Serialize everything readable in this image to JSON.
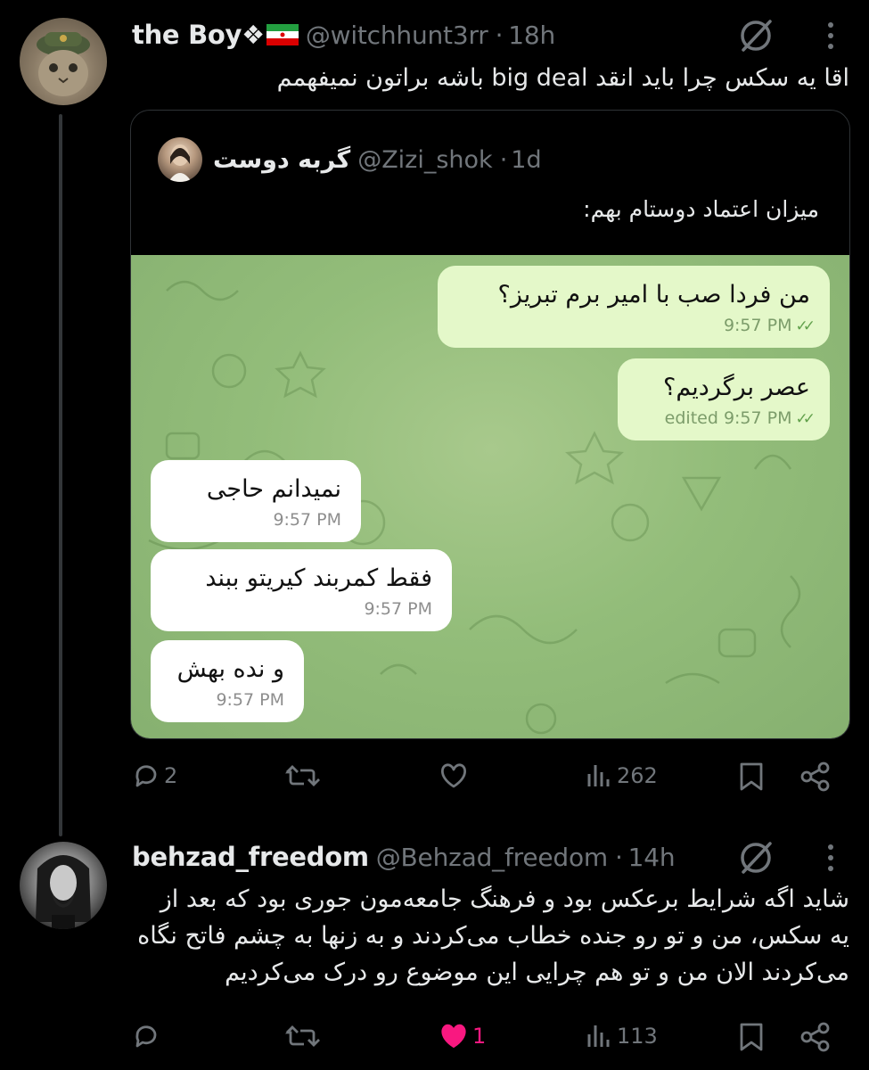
{
  "tweet1": {
    "name": "the Boy❖",
    "flag_color_top": "#239f40",
    "flag_color_bottom": "#da0000",
    "handle": "@witchhunt3rr",
    "time": "18h",
    "text": "اقا یه سکس چرا باید انقد big deal باشه براتون نمیفهمم",
    "quote": {
      "name": "گربه دوست",
      "handle": "@Zizi_shok",
      "time": "1d",
      "text": "میزان اعتماد دوستام بهم:",
      "messages": [
        {
          "text": "من فردا صب با امیر برم تبریز؟",
          "time": "9:57 PM",
          "direction": "out"
        },
        {
          "text": "عصر برگردیم؟",
          "time": "edited 9:57 PM",
          "direction": "out"
        },
        {
          "text": "نمیدانم حاجی",
          "time": "9:57 PM",
          "direction": "in"
        },
        {
          "text": "فقط کمربند کیریتو ببند",
          "time": "9:57 PM",
          "direction": "in"
        },
        {
          "text": "و نده بهش",
          "time": "9:57 PM",
          "direction": "in"
        }
      ]
    },
    "actions": {
      "replies": "2",
      "retweets": "",
      "likes": "",
      "views": "262"
    }
  },
  "tweet2": {
    "name": "behzad_freedom",
    "handle": "@Behzad_freedom",
    "time": "14h",
    "lines": [
      "شاید اگه شرایط برعکس بود و فرهنگ جامعه‌مون جوری بود که بعد از",
      "یه سکس، من و تو رو جنده خطاب می‌کردند و به زنها به چشم فاتح نگاه",
      "می‌کردند الان من و تو هم چرایی این موضوع رو درک می‌کردیم"
    ],
    "actions": {
      "replies": "",
      "retweets": "",
      "likes": "1",
      "views": "113"
    }
  },
  "separator": "·",
  "icons": [
    "grok-icon",
    "more-icon",
    "reply-icon",
    "retweet-icon",
    "like-icon",
    "views-icon",
    "bookmark-icon",
    "share-icon"
  ]
}
